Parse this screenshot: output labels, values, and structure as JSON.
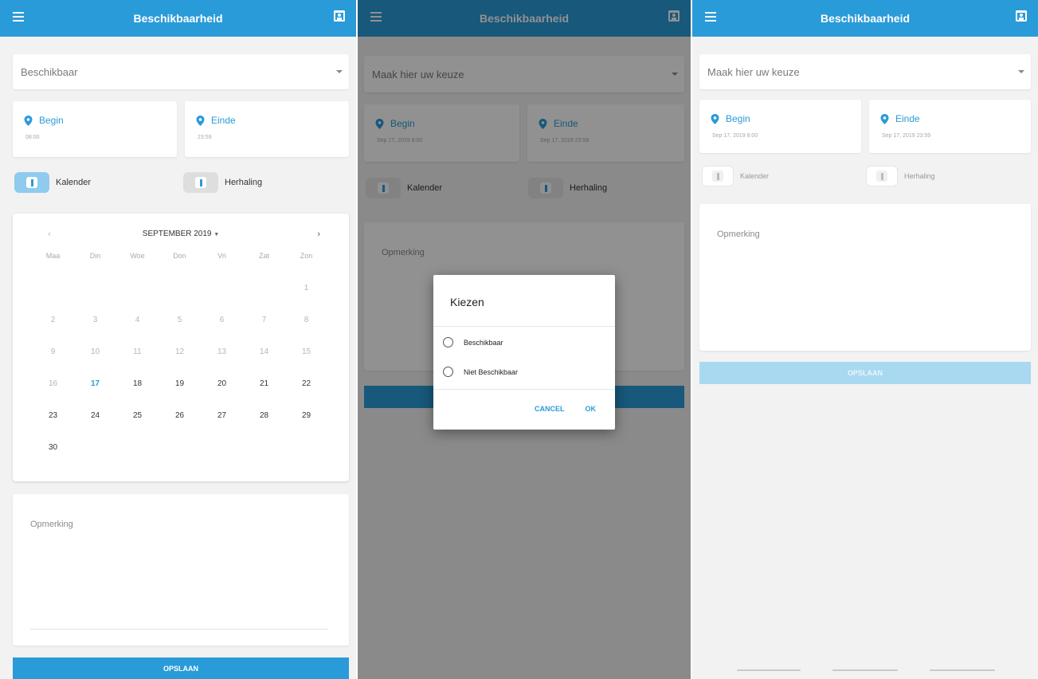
{
  "app": {
    "title": "Beschikbaarheid"
  },
  "colors": {
    "accent": "#2a9bd9",
    "background": "#f2f2f3"
  },
  "icons": {
    "menu": "hamburger-icon",
    "calendar": "calendar-person-icon",
    "pin": "location-pin-icon",
    "caret": "caret-down-icon"
  },
  "screen1": {
    "dropdown_value": "Beschikbaar",
    "begin": {
      "label": "Begin",
      "value": "08:00"
    },
    "end": {
      "label": "Einde",
      "value": "23:59"
    },
    "toggles": {
      "calendar_label": "Kalender",
      "repeat_label": "Herhaling"
    },
    "calendar": {
      "month": "SEPTEMBER 2019",
      "prev": "‹",
      "next": "›",
      "weekdays": [
        "Maa",
        "Din",
        "Woe",
        "Don",
        "Vri",
        "Zat",
        "Zon"
      ],
      "today": "17"
    },
    "remark_placeholder": "Opmerking",
    "save_label": "OPSLAAN"
  },
  "screen2": {
    "dropdown_value": "Maak hier uw keuze",
    "begin": {
      "label": "Begin",
      "value": "Sep 17, 2019 8:00"
    },
    "end": {
      "label": "Einde",
      "value": "Sep 17, 2019 23:59"
    },
    "toggles": {
      "calendar_label": "Kalender",
      "repeat_label": "Herhaling"
    },
    "remark_placeholder": "Opmerking",
    "dialog": {
      "title": "Kiezen",
      "options": [
        "Beschikbaar",
        "Niet Beschikbaar"
      ],
      "cancel": "CANCEL",
      "ok": "OK"
    }
  },
  "screen3": {
    "dropdown_value": "Maak hier uw keuze",
    "begin": {
      "label": "Begin",
      "value": "Sep 17, 2019 8:00"
    },
    "end": {
      "label": "Einde",
      "value": "Sep 17, 2019 23:59"
    },
    "toggles": {
      "calendar_label": "Kalender",
      "repeat_label": "Herhaling"
    },
    "remark_placeholder": "Opmerking",
    "save_label": "OPSLAAN"
  }
}
